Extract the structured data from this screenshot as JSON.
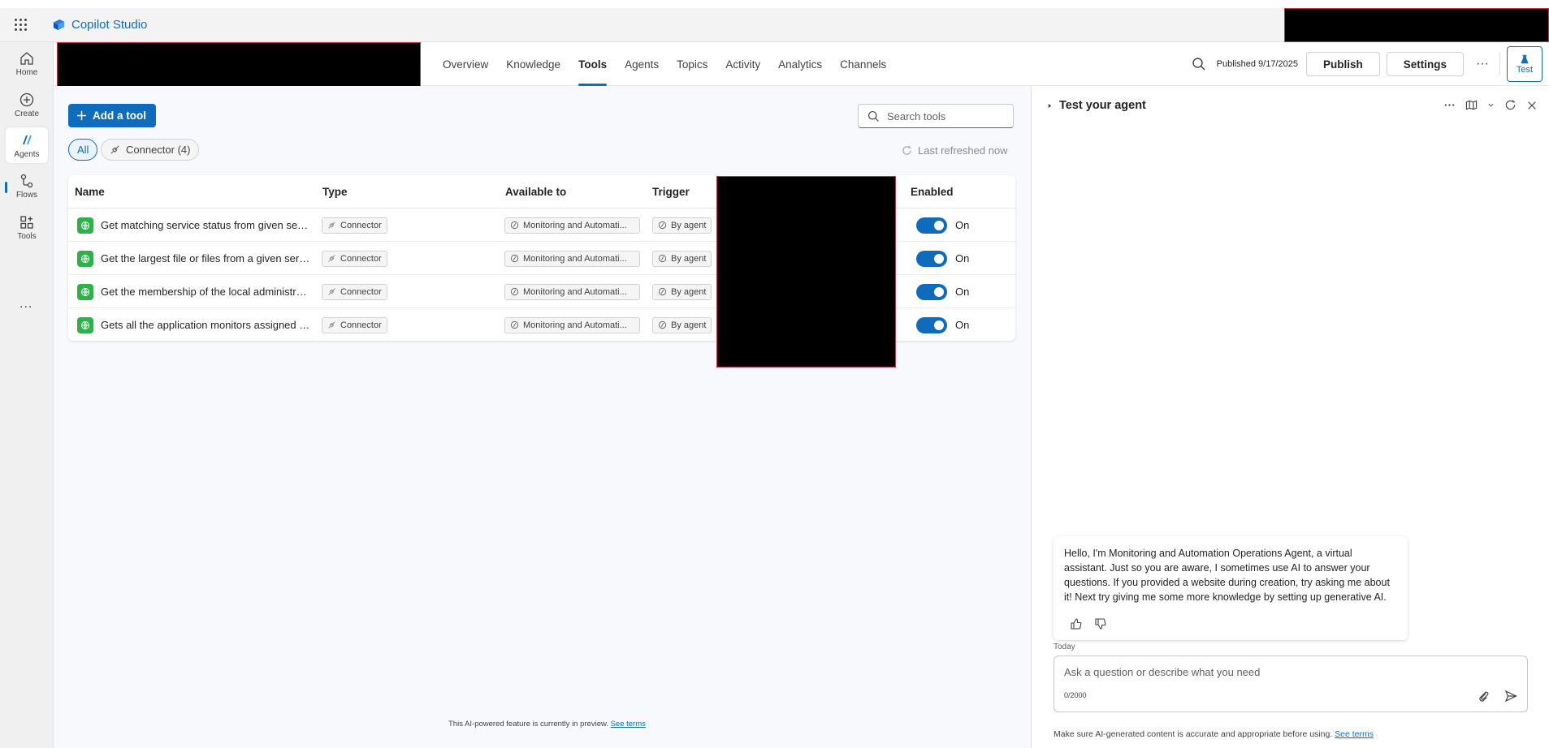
{
  "app": {
    "name": "Copilot Studio"
  },
  "rail": {
    "items": [
      {
        "label": "Home",
        "icon": "home-icon"
      },
      {
        "label": "Create",
        "icon": "plus-circle-icon"
      },
      {
        "label": "Agents",
        "icon": "agents-icon",
        "active": true
      },
      {
        "label": "Flows",
        "icon": "flows-icon"
      },
      {
        "label": "Tools",
        "icon": "tools-icon"
      }
    ],
    "more": "..."
  },
  "header": {
    "tabs": [
      {
        "label": "Overview"
      },
      {
        "label": "Knowledge"
      },
      {
        "label": "Tools",
        "active": true
      },
      {
        "label": "Agents"
      },
      {
        "label": "Topics"
      },
      {
        "label": "Activity"
      },
      {
        "label": "Analytics"
      },
      {
        "label": "Channels"
      }
    ],
    "published": "Published 9/17/2025",
    "publish_label": "Publish",
    "settings_label": "Settings",
    "more": "···",
    "test_label": "Test"
  },
  "tools": {
    "add_label": "Add a tool",
    "search_placeholder": "Search tools",
    "filters": {
      "all": "All",
      "connector": "Connector (4)"
    },
    "last_refreshed": "Last refreshed now",
    "columns": {
      "name": "Name",
      "type": "Type",
      "available_to": "Available to",
      "trigger": "Trigger",
      "enabled": "Enabled"
    },
    "rows": [
      {
        "name": "Get matching service status from given serv...",
        "type": "Connector",
        "available_to": "Monitoring and Automati...",
        "trigger": "By agent",
        "enabled": "On"
      },
      {
        "name": "Get the largest file or files from a given serv...",
        "type": "Connector",
        "available_to": "Monitoring and Automati...",
        "trigger": "By agent",
        "enabled": "On"
      },
      {
        "name": "Get the membership of the local administrat...",
        "type": "Connector",
        "available_to": "Monitoring and Automati...",
        "trigger": "By agent",
        "enabled": "On"
      },
      {
        "name": "Gets all the application monitors assigned in...",
        "type": "Connector",
        "available_to": "Monitoring and Automati...",
        "trigger": "By agent",
        "enabled": "On"
      }
    ],
    "preview_note": "This AI-powered feature is currently in preview.",
    "see_terms": "See terms"
  },
  "test_panel": {
    "title": "Test your agent",
    "message": "Hello, I'm Monitoring and Automation Operations Agent, a virtual assistant. Just so you are aware, I sometimes use AI to answer your questions. If you provided a website during creation, try asking me about it! Next try giving me some more knowledge by setting up generative AI.",
    "today": "Today",
    "input_placeholder": "Ask a question or describe what you need",
    "counter": "0/2000",
    "disclaimer": "Make sure AI-generated content is accurate and appropriate before using.",
    "see_terms": "See terms"
  },
  "colors": {
    "accent": "#0f6cbd",
    "tool_icon": "#2db24a",
    "redaction": "#000000"
  }
}
